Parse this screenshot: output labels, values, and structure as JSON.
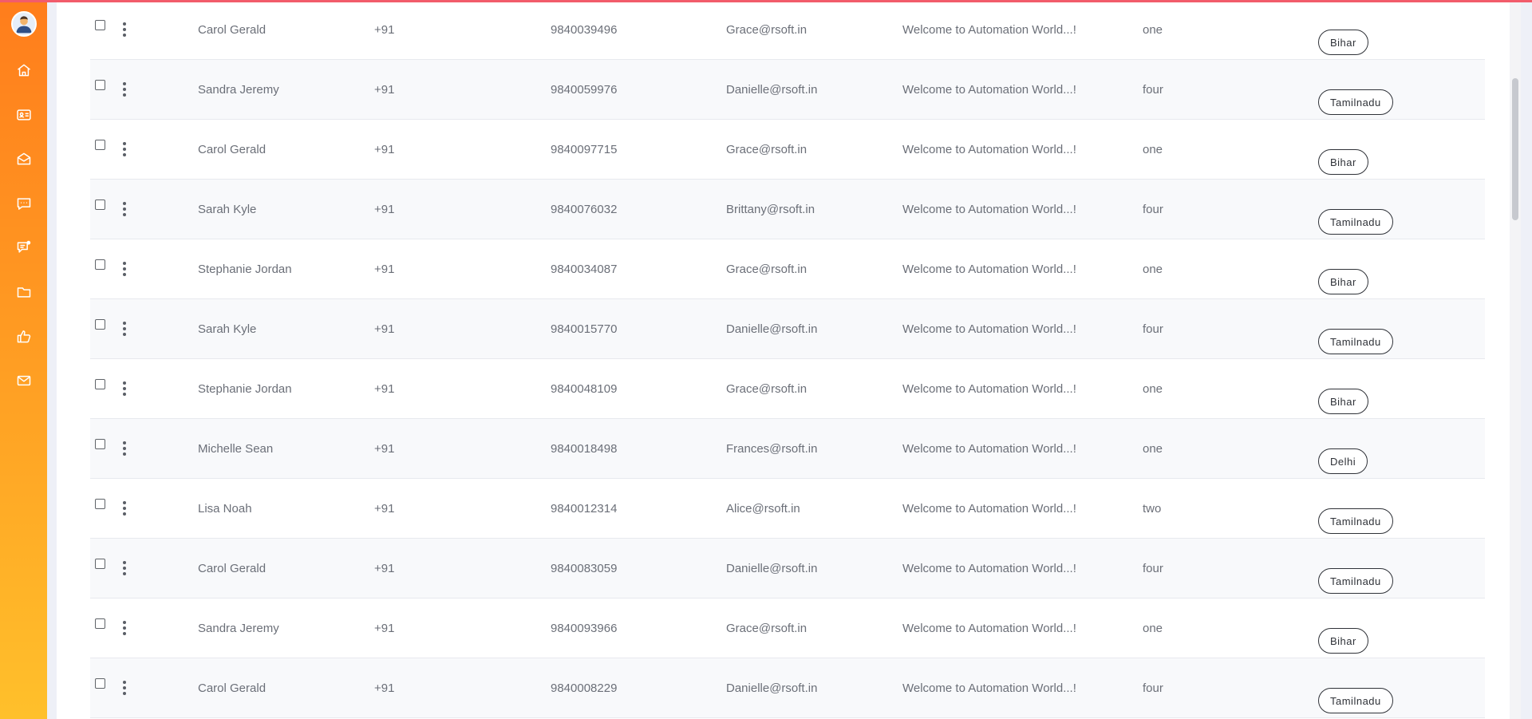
{
  "sidebar": {
    "icons": [
      "avatar",
      "home-icon",
      "id-card-icon",
      "mail-open-icon",
      "chat-icon",
      "notes-icon",
      "folder-icon",
      "thumbs-up-icon",
      "envelope-icon"
    ]
  },
  "colors": {
    "sidebar_top": "#ff7d1c",
    "sidebar_bottom": "#ffc02b",
    "top_accent": "#f25c6b"
  },
  "table": {
    "rows": [
      {
        "name": "Carol Gerald",
        "code": "+91",
        "phone": "9840039496",
        "email": "Grace@rsoft.in",
        "message": "Welcome to Automation World...!",
        "number": "one",
        "state": "Bihar"
      },
      {
        "name": "Sandra Jeremy",
        "code": "+91",
        "phone": "9840059976",
        "email": "Danielle@rsoft.in",
        "message": "Welcome to Automation World...!",
        "number": "four",
        "state": "Tamilnadu"
      },
      {
        "name": "Carol Gerald",
        "code": "+91",
        "phone": "9840097715",
        "email": "Grace@rsoft.in",
        "message": "Welcome to Automation World...!",
        "number": "one",
        "state": "Bihar"
      },
      {
        "name": "Sarah Kyle",
        "code": "+91",
        "phone": "9840076032",
        "email": "Brittany@rsoft.in",
        "message": "Welcome to Automation World...!",
        "number": "four",
        "state": "Tamilnadu"
      },
      {
        "name": "Stephanie Jordan",
        "code": "+91",
        "phone": "9840034087",
        "email": "Grace@rsoft.in",
        "message": "Welcome to Automation World...!",
        "number": "one",
        "state": "Bihar"
      },
      {
        "name": "Sarah Kyle",
        "code": "+91",
        "phone": "9840015770",
        "email": "Danielle@rsoft.in",
        "message": "Welcome to Automation World...!",
        "number": "four",
        "state": "Tamilnadu"
      },
      {
        "name": "Stephanie Jordan",
        "code": "+91",
        "phone": "9840048109",
        "email": "Grace@rsoft.in",
        "message": "Welcome to Automation World...!",
        "number": "one",
        "state": "Bihar"
      },
      {
        "name": "Michelle Sean",
        "code": "+91",
        "phone": "9840018498",
        "email": "Frances@rsoft.in",
        "message": "Welcome to Automation World...!",
        "number": "one",
        "state": "Delhi"
      },
      {
        "name": "Lisa Noah",
        "code": "+91",
        "phone": "9840012314",
        "email": "Alice@rsoft.in",
        "message": "Welcome to Automation World...!",
        "number": "two",
        "state": "Tamilnadu"
      },
      {
        "name": "Carol Gerald",
        "code": "+91",
        "phone": "9840083059",
        "email": "Danielle@rsoft.in",
        "message": "Welcome to Automation World...!",
        "number": "four",
        "state": "Tamilnadu"
      },
      {
        "name": "Sandra Jeremy",
        "code": "+91",
        "phone": "9840093966",
        "email": "Grace@rsoft.in",
        "message": "Welcome to Automation World...!",
        "number": "one",
        "state": "Bihar"
      },
      {
        "name": "Carol Gerald",
        "code": "+91",
        "phone": "9840008229",
        "email": "Danielle@rsoft.in",
        "message": "Welcome to Automation World...!",
        "number": "four",
        "state": "Tamilnadu"
      }
    ]
  }
}
